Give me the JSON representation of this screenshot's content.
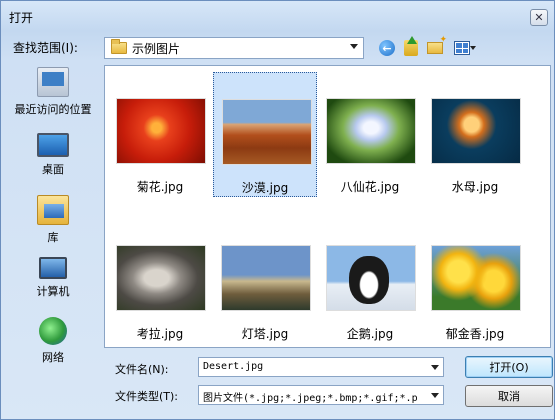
{
  "window": {
    "title": "打开",
    "close_glyph": "✕"
  },
  "lookin": {
    "label": "查找范围(I):",
    "value": "示例图片"
  },
  "toolbar": {
    "icons": [
      "back-icon",
      "up-folder-icon",
      "new-folder-icon",
      "views-menu-icon"
    ]
  },
  "places": [
    {
      "label": "最近访问的位置",
      "icon": "recent-places-icon"
    },
    {
      "label": "桌面",
      "icon": "desktop-icon"
    },
    {
      "label": "库",
      "icon": "libraries-icon"
    },
    {
      "label": "计算机",
      "icon": "computer-icon"
    },
    {
      "label": "网络",
      "icon": "network-icon"
    }
  ],
  "files": [
    {
      "name": "菊花.jpg",
      "selected": false
    },
    {
      "name": "沙漠.jpg",
      "selected": true
    },
    {
      "name": "八仙花.jpg",
      "selected": false
    },
    {
      "name": "水母.jpg",
      "selected": false
    },
    {
      "name": "考拉.jpg",
      "selected": false
    },
    {
      "name": "灯塔.jpg",
      "selected": false
    },
    {
      "name": "企鹅.jpg",
      "selected": false
    },
    {
      "name": "郁金香.jpg",
      "selected": false
    }
  ],
  "filename": {
    "label": "文件名(N):",
    "value": "Desert.jpg"
  },
  "filetype": {
    "label": "文件类型(T):",
    "value": "图片文件(*.jpg;*.jpeg;*.bmp;*.gif;*.p"
  },
  "buttons": {
    "open": "打开(O)",
    "cancel": "取消"
  }
}
